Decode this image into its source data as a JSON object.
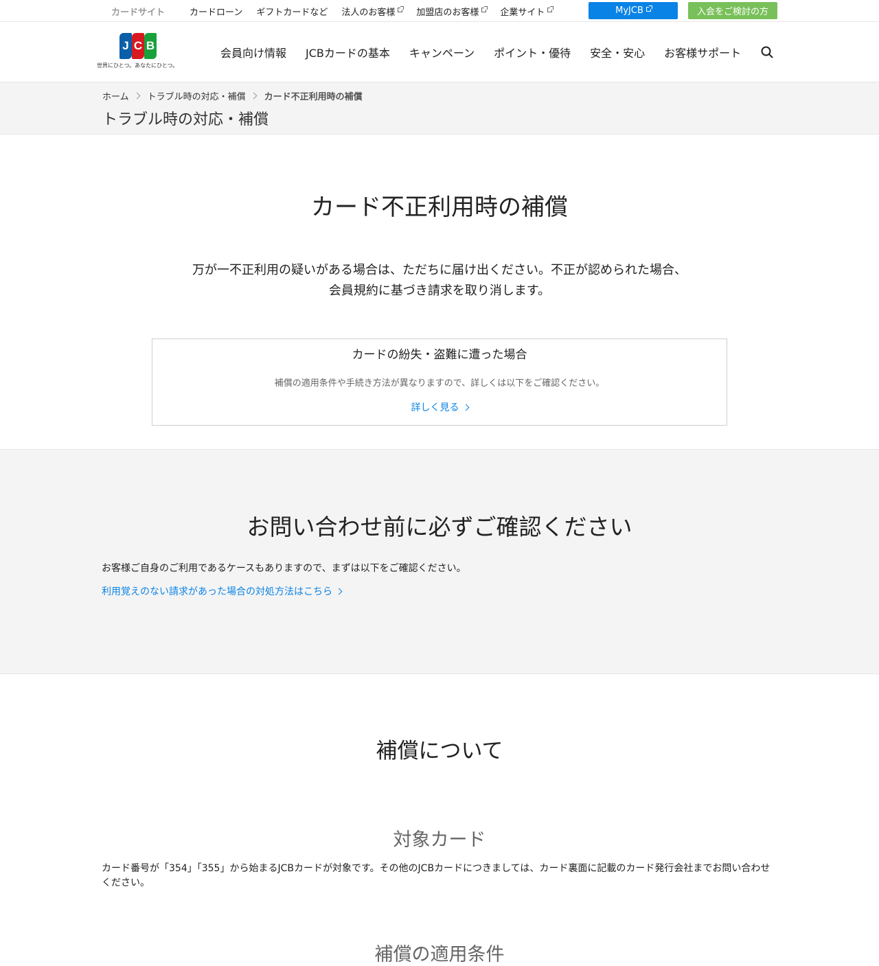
{
  "utility": {
    "site_label": "カードサイト",
    "links": [
      "カードローン",
      "ギフトカードなど",
      "法人のお客様",
      "加盟店のお客様",
      "企業サイト"
    ],
    "myjcb_label": "MyJCB",
    "join_label": "入会をご検討の方"
  },
  "brand": {
    "logo_letters": [
      "J",
      "C",
      "B"
    ],
    "tagline": "世界にひとつ。あなたにひとつ。",
    "colors": {
      "blue": "#0b5ea8",
      "red": "#d71920",
      "green": "#18a13a",
      "accent": "#0a83e6",
      "join": "#79c05a"
    }
  },
  "nav": {
    "items": [
      "会員向け情報",
      "JCBカードの基本",
      "キャンペーン",
      "ポイント・優待",
      "安全・安心",
      "お客様サポート"
    ],
    "search_icon": "search-icon"
  },
  "breadcrumb": {
    "items": [
      "ホーム",
      "トラブル時の対応・補償",
      "カード不正利用時の補償"
    ],
    "section_title": "トラブル時の対応・補償"
  },
  "main": {
    "title": "カード不正利用時の補償",
    "lead_line1": "万が一不正利用の疑いがある場合は、ただちに届け出ください。不正が認められた場合、",
    "lead_line2": "会員規約に基づき請求を取り消します。",
    "card": {
      "title": "カードの紛失・盗難に遭った場合",
      "text": "補償の適用条件や手続き方法が異なりますので、詳しくは以下をご確認ください。",
      "link": "詳しく見る"
    }
  },
  "notice": {
    "title": "お問い合わせ前に必ずご確認ください",
    "text": "お客様ご自身のご利用であるケースもありますので、まずは以下をご確認ください。",
    "link": "利用覚えのない請求があった場合の対処方法はこちら"
  },
  "compensation": {
    "title": "補償について",
    "target_title": "対象カード",
    "target_text": "カード番号が「354」「355」から始まるJCBカードが対象です。その他のJCBカードにつきましては、カード裏面に記載のカード発行会社までお問い合わせください。",
    "conditions_title": "補償の適用条件"
  }
}
